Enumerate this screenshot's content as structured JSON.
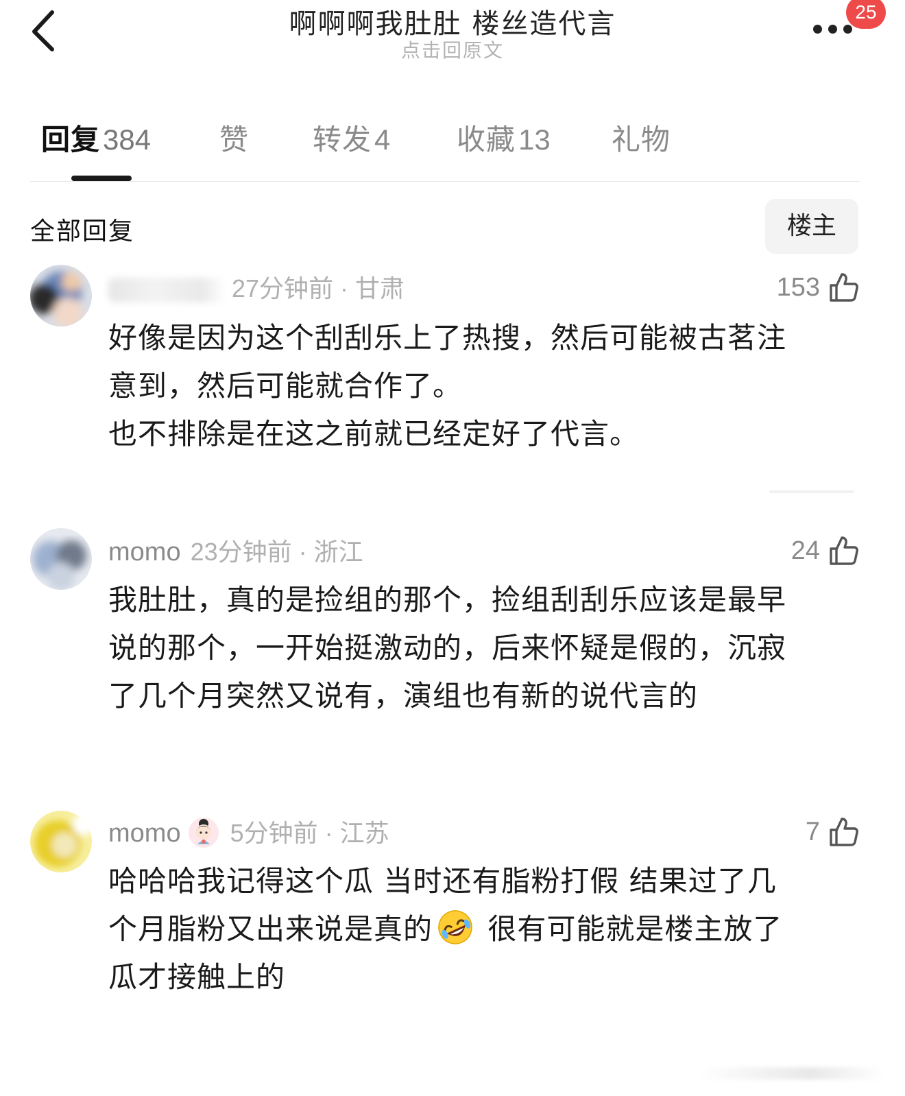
{
  "header": {
    "title": "啊啊啊我肚肚 楼丝造代言",
    "subtitle": "点击回原文",
    "back_icon": "chevron-left-icon",
    "more_icon": "more-dots-icon",
    "notification_count": "25",
    "badge_color": "#ee4a4a"
  },
  "tabs": [
    {
      "label": "回复",
      "count": "384",
      "active": true
    },
    {
      "label": "赞",
      "count": "",
      "active": false
    },
    {
      "label": "转发",
      "count": "4",
      "active": false
    },
    {
      "label": "收藏",
      "count": "13",
      "active": false
    },
    {
      "label": "礼物",
      "count": "",
      "active": false
    }
  ],
  "section": {
    "label": "全部回复",
    "filter_button": "楼主"
  },
  "comments": [
    {
      "username": "",
      "time": "27分钟前",
      "location": "甘肃",
      "meta_sep": " · ",
      "likes": "153",
      "lines": [
        "好像是因为这个刮刮乐上了热搜，然后可能被古茗注",
        "意到，然后可能就合作了。",
        "也不排除是在这之前就已经定好了代言。"
      ]
    },
    {
      "username": "momo",
      "time": "23分钟前",
      "location": "浙江",
      "meta_sep": " · ",
      "likes": "24",
      "lines": [
        "我肚肚，真的是捡组的那个，捡组刮刮乐应该是最早",
        "说的那个，一开始挺激动的，后来怀疑是假的，沉寂",
        "了几个月突然又说有，演组也有新的说代言的"
      ]
    },
    {
      "username": "momo",
      "time": "5分钟前",
      "location": "江苏",
      "meta_sep": " · ",
      "likes": "7",
      "line1": "哈哈哈我记得这个瓜 当时还有脂粉打假 结果过了几",
      "line2_a": "个月脂粉又出来说是真的",
      "line2_b": " 很有可能就是楼主放了",
      "line3": "瓜才接触上的",
      "emoji": "rolling-laughing-emoji"
    }
  ],
  "colors": {
    "text_primary": "#1a1a1a",
    "text_secondary": "#8a8a8a",
    "text_tertiary": "#b0b0b0"
  }
}
